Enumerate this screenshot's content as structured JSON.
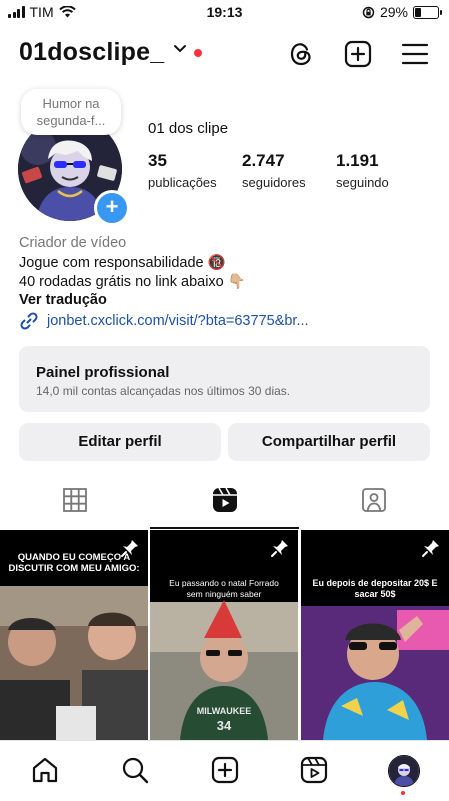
{
  "status_bar": {
    "carrier": "TIM",
    "time": "19:13",
    "battery_text": "29%",
    "battery_level": 0.29
  },
  "header": {
    "username": "01dosclipe_",
    "icons": [
      "threads-icon",
      "create-icon",
      "menu-icon"
    ]
  },
  "profile": {
    "note": "Humor na segunda-f...",
    "display_name": "01 dos clipe",
    "stats": [
      {
        "value": "35",
        "label": "publicações"
      },
      {
        "value": "2.747",
        "label": "seguidores"
      },
      {
        "value": "1.191",
        "label": "seguindo"
      }
    ],
    "category": "Criador de vídeo",
    "bio_line1": "Jogue com responsabilidade 🔞",
    "bio_line2": "40 rodadas grátis no link abaixo 👇🏼",
    "translate": "Ver tradução",
    "link": "jonbet.cxclick.com/visit/?bta=63775&br..."
  },
  "professional_panel": {
    "title": "Painel profissional",
    "subtitle": "14,0 mil contas alcançadas nos últimos 30 dias."
  },
  "actions": {
    "edit": "Editar perfil",
    "share": "Compartilhar perfil"
  },
  "tabs": [
    "grid-tab",
    "reels-tab",
    "tagged-tab"
  ],
  "posts": [
    {
      "caption": "QUANDO EU COMEÇO A DISCUTIR COM MEU AMIGO:",
      "pinned": true
    },
    {
      "caption": "Eu passando o natal Forrado sem ninguém saber",
      "pinned": true
    },
    {
      "caption": "Eu depois de depositar 20$ E sacar 50$",
      "pinned": true
    }
  ],
  "bottom_nav": [
    "home-icon",
    "search-icon",
    "create-icon",
    "reels-icon",
    "profile-avatar"
  ]
}
